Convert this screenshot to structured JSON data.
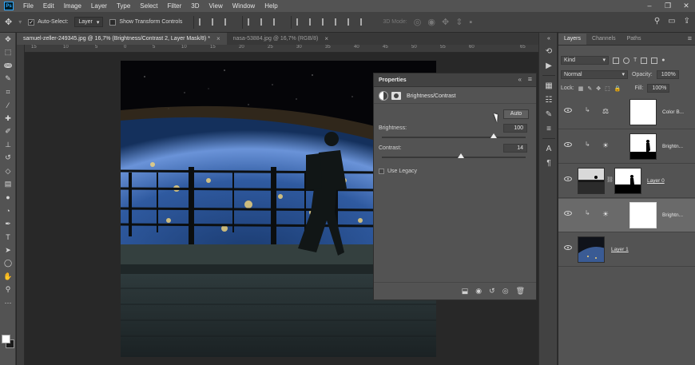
{
  "menu": [
    "File",
    "Edit",
    "Image",
    "Layer",
    "Type",
    "Select",
    "Filter",
    "3D",
    "View",
    "Window",
    "Help"
  ],
  "app_logo": "Ps",
  "window_controls": [
    "–",
    "❐",
    "✕"
  ],
  "options": {
    "auto_select_label": "Auto-Select:",
    "auto_select_value": "Layer",
    "transform_label": "Show Transform Controls",
    "mode_3d_label": "3D Mode:"
  },
  "tabs": [
    {
      "label": "samuel-zeller-249345.jpg @ 16,7% (Brightness/Contrast 2, Layer Mask/8) *",
      "active": true
    },
    {
      "label": "nasa-53884.jpg @ 16,7% (RGB/8)",
      "active": false
    }
  ],
  "ruler_top": [
    "15",
    "10",
    "5",
    "0",
    "5",
    "10",
    "15",
    "20",
    "25",
    "30",
    "35",
    "40",
    "45",
    "50",
    "55",
    "60",
    "65"
  ],
  "properties": {
    "title": "Properties",
    "subtitle": "Brightness/Contrast",
    "auto_label": "Auto",
    "brightness_label": "Brightness:",
    "brightness_value": "100",
    "brightness_fraction": 0.78,
    "contrast_label": "Contrast:",
    "contrast_value": "14",
    "contrast_fraction": 0.55,
    "legacy_label": "Use Legacy"
  },
  "layers_panel": {
    "tabs": [
      "Layers",
      "Channels",
      "Paths"
    ],
    "filter_value": "Kind",
    "blend_mode": "Normal",
    "opacity_label": "Opacity:",
    "opacity_value": "100%",
    "lock_label": "Lock:",
    "fill_label": "Fill:",
    "fill_value": "100%",
    "layers": [
      {
        "name": "Color B...",
        "kind": "adjustment",
        "adjust_icon": "color-balance-icon",
        "clipped": true,
        "selected": false
      },
      {
        "name": "Brightn...",
        "kind": "adjustment",
        "adjust_icon": "brightness-icon",
        "clipped": true,
        "selected": false
      },
      {
        "name": "Layer 0",
        "kind": "image-with-mask",
        "clipped": false,
        "selected": false
      },
      {
        "name": "Brightn...",
        "kind": "adjustment",
        "adjust_icon": "brightness-icon",
        "clipped": true,
        "selected": true
      },
      {
        "name": "Layer 1",
        "kind": "image",
        "clipped": false,
        "selected": false
      }
    ]
  },
  "colors": {
    "app_bg": "#282828",
    "panel": "#535353",
    "accent": "#31a8ff"
  }
}
